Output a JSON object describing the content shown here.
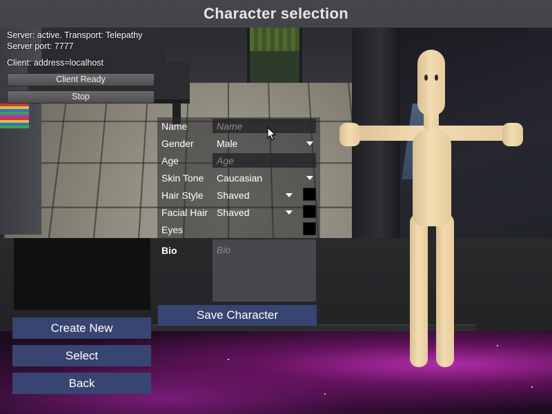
{
  "title": "Character selection",
  "network": {
    "status_line": "Server: active. Transport: Telepathy",
    "port_line": "Server port: 7777",
    "client_line": "Client: address=localhost",
    "client_ready_label": "Client Ready",
    "stop_label": "Stop"
  },
  "character_list": [],
  "actions": {
    "create_new": "Create New",
    "select": "Select",
    "back": "Back"
  },
  "form": {
    "name": {
      "label": "Name",
      "value": "",
      "placeholder": "Name"
    },
    "gender": {
      "label": "Gender",
      "value": "Male"
    },
    "age": {
      "label": "Age",
      "value": "",
      "placeholder": "Age"
    },
    "skin_tone": {
      "label": "Skin Tone",
      "value": "Caucasian"
    },
    "hair_style": {
      "label": "Hair Style",
      "value": "Shaved",
      "color": "#000000"
    },
    "facial_hair": {
      "label": "Facial Hair",
      "value": "Shaved",
      "color": "#000000"
    },
    "eyes": {
      "label": "Eyes",
      "color": "#000000"
    },
    "bio": {
      "label": "Bio",
      "value": "",
      "placeholder": "Bio"
    },
    "save_label": "Save Character"
  },
  "colors": {
    "button_blue": "#384471",
    "title_text": "#e6e6e6",
    "skin": "#f3dcb2"
  },
  "icons": {
    "dropdown": "chevron-down-icon",
    "cursor": "mouse-pointer-icon"
  }
}
